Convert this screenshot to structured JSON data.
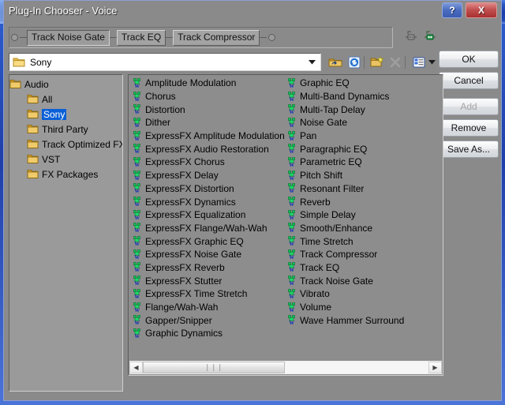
{
  "window": {
    "title": "Plug-In Chooser - Voice",
    "titlebar_buttons": [
      {
        "name": "help-button",
        "label": "?"
      },
      {
        "name": "close-button",
        "label": "X"
      }
    ]
  },
  "chain": {
    "items": [
      {
        "label": "Track Noise Gate",
        "state": "sunken"
      },
      {
        "label": "Track EQ",
        "state": "raised"
      },
      {
        "label": "Track Compressor",
        "state": "raised"
      }
    ],
    "icons": [
      {
        "name": "chain-insert-left-icon"
      },
      {
        "name": "chain-insert-right-icon"
      }
    ]
  },
  "side_buttons": [
    {
      "label": "OK",
      "name": "ok-button",
      "disabled": false
    },
    {
      "label": "Cancel",
      "name": "cancel-button",
      "disabled": false
    },
    {
      "label": "Add",
      "name": "add-button",
      "disabled": true
    },
    {
      "label": "Remove",
      "name": "remove-button",
      "disabled": false
    },
    {
      "label": "Save As...",
      "name": "save-as-button",
      "disabled": false
    }
  ],
  "address": {
    "value": "Sony",
    "folder_icon": "folder-icon",
    "dropdown_icon": "chevron-down-icon",
    "toolbar": [
      {
        "name": "up-one-level-icon"
      },
      {
        "name": "refresh-icon"
      },
      {
        "name": "new-folder-icon"
      },
      {
        "name": "delete-icon"
      },
      {
        "name": "views-icon"
      },
      {
        "name": "views-chevron-down-icon"
      }
    ]
  },
  "tree": {
    "nodes": [
      {
        "label": "Audio",
        "level": 0,
        "selected": false
      },
      {
        "label": "All",
        "level": 1,
        "selected": false
      },
      {
        "label": "Sony",
        "level": 1,
        "selected": true
      },
      {
        "label": "Third Party",
        "level": 1,
        "selected": false
      },
      {
        "label": "Track Optimized FX",
        "level": 1,
        "selected": false
      },
      {
        "label": "VST",
        "level": 1,
        "selected": false
      },
      {
        "label": "FX Packages",
        "level": 1,
        "selected": false
      }
    ]
  },
  "list": {
    "icon": "plugin-icon",
    "columns": [
      [
        "Amplitude Modulation",
        "Chorus",
        "Distortion",
        "Dither",
        "ExpressFX Amplitude Modulation",
        "ExpressFX Audio Restoration",
        "ExpressFX Chorus",
        "ExpressFX Delay",
        "ExpressFX Distortion",
        "ExpressFX Dynamics",
        "ExpressFX Equalization",
        "ExpressFX Flange/Wah-Wah",
        "ExpressFX Graphic EQ",
        "ExpressFX Noise Gate",
        "ExpressFX Reverb",
        "ExpressFX Stutter",
        "ExpressFX Time Stretch",
        "Flange/Wah-Wah",
        "Gapper/Snipper",
        "Graphic Dynamics"
      ],
      [
        "Graphic EQ",
        "Multi-Band Dynamics",
        "Multi-Tap Delay",
        "Noise Gate",
        "Pan",
        "Paragraphic EQ",
        "Parametric EQ",
        "Pitch Shift",
        "Resonant Filter",
        "Reverb",
        "Simple Delay",
        "Smooth/Enhance",
        "Time Stretch",
        "Track Compressor",
        "Track EQ",
        "Track Noise Gate",
        "Vibrato",
        "Volume",
        "Wave Hammer Surround"
      ]
    ],
    "scrollbar": {
      "left_arrow": "◀",
      "right_arrow": "▶",
      "grip": "❘❘❘"
    }
  },
  "colors": {
    "titlebar_start": "#4e7fe0",
    "titlebar_end": "#1c3ea8",
    "dialog_face": "#8a8a8a",
    "selection": "#0a5fd6",
    "close_button": "#c25050"
  }
}
